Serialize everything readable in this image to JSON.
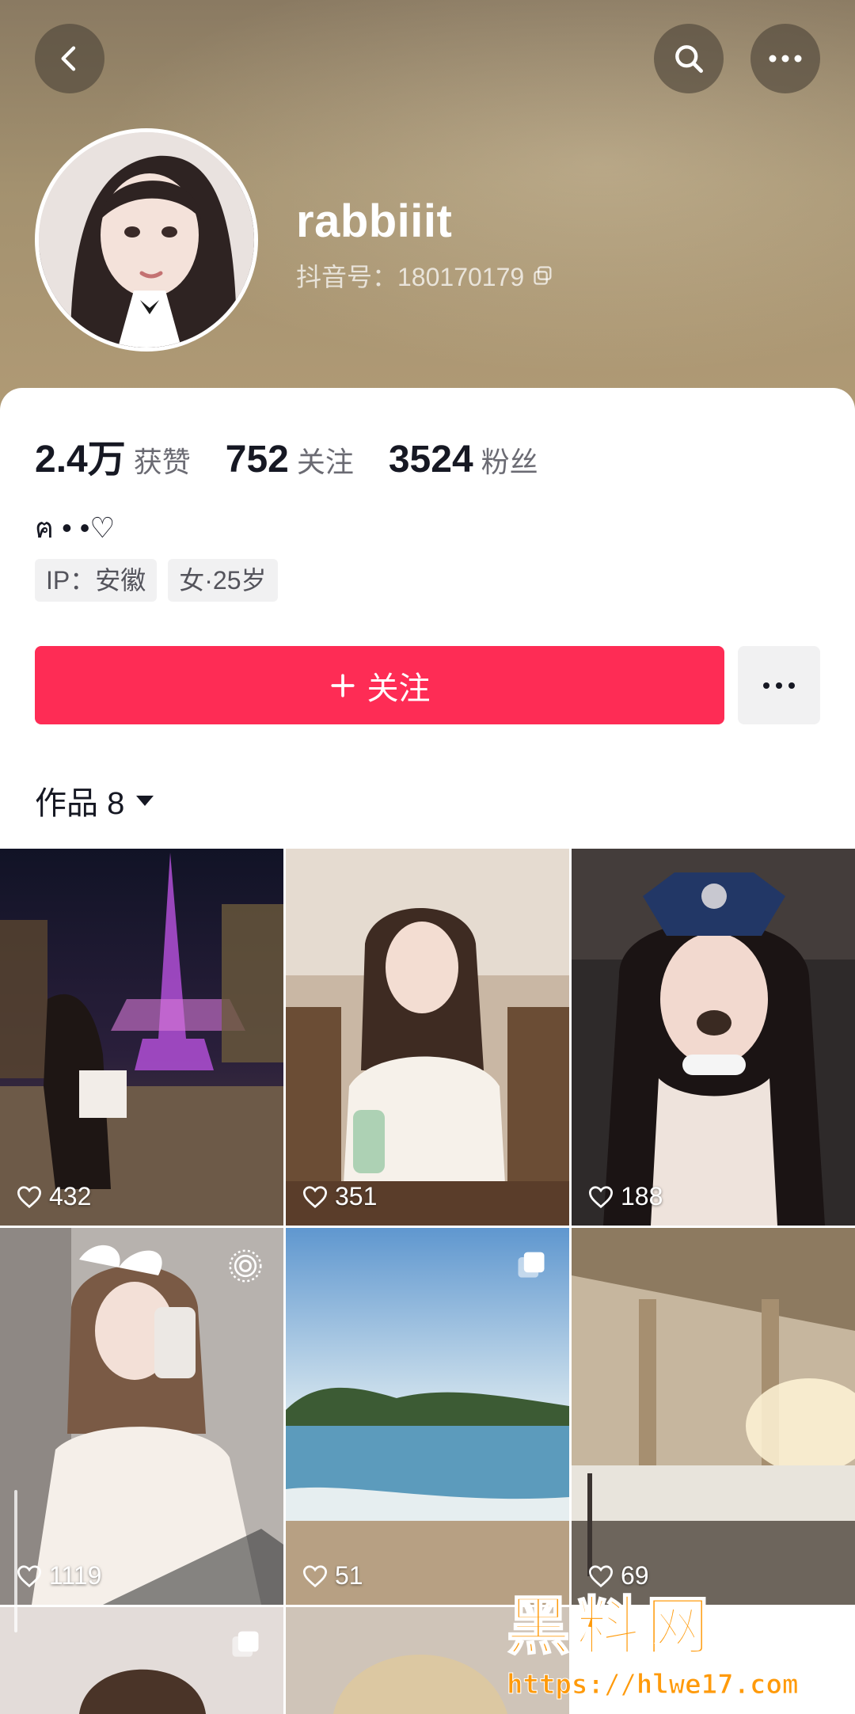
{
  "header": {
    "back_icon": "chevron-left-icon",
    "search_icon": "search-icon",
    "more_icon": "more-horizontal-icon"
  },
  "profile": {
    "username": "rabbiiit",
    "douyin_id": "抖音号：180170179",
    "copy_icon": "copy-icon"
  },
  "stats": [
    {
      "value": "2.4万",
      "label": "获赞"
    },
    {
      "value": "752",
      "label": "关注"
    },
    {
      "value": "3524",
      "label": "粉丝"
    }
  ],
  "bio": "ฅ • •♡",
  "tags": [
    "IP：安徽",
    "女·25岁"
  ],
  "actions": {
    "follow_label": "关注",
    "follow_icon": "plus-icon",
    "more_icon": "more-horizontal-icon"
  },
  "works": {
    "label": "作品 8",
    "dropdown_icon": "caret-down-icon"
  },
  "videos": [
    {
      "likes": "432",
      "scene": "night-tower"
    },
    {
      "likes": "351",
      "scene": "cafe-portrait"
    },
    {
      "likes": "188",
      "scene": "puppy-filter"
    },
    {
      "likes": "1119",
      "scene": "mirror-selfie",
      "badge": "live-photo-icon"
    },
    {
      "likes": "51",
      "scene": "beach",
      "badge": "multi-image-icon"
    },
    {
      "likes": "69",
      "scene": "train-station"
    },
    {
      "likes": "",
      "scene": "portrait-partial",
      "badge": "multi-image-icon"
    },
    {
      "likes": "",
      "scene": "blonde-partial"
    }
  ],
  "watermark": {
    "title": "黑料网",
    "url": "https://hlwe17.com"
  },
  "colors": {
    "accent": "#fe2c55",
    "watermark": "#ff9a0a"
  }
}
